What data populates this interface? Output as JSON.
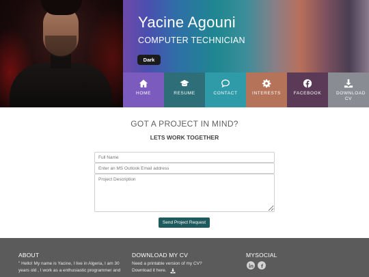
{
  "profile": {
    "name": "Yacine Agouni",
    "role": "COMPUTER TECHNICIAN",
    "theme_button": "Dark"
  },
  "nav": [
    {
      "label": "HOME",
      "icon": "home-icon",
      "color": "#7b5bbd"
    },
    {
      "label": "RESUME",
      "icon": "graduation-cap-icon",
      "color": "#2e6e78"
    },
    {
      "label": "CONTACT",
      "icon": "comment-icon",
      "color": "#2f9aa8"
    },
    {
      "label": "INTERESTS",
      "icon": "gear-icon",
      "color": "#b5735a"
    },
    {
      "label": "FACEBOOK",
      "icon": "facebook-icon",
      "color": "#5a3a56"
    },
    {
      "label": "DOWNLOAD CV",
      "icon": "download-icon",
      "color": "#8a8c93"
    }
  ],
  "contact": {
    "title": "GOT A PROJECT IN MIND?",
    "subtitle": "LETS WORK TOGETHER",
    "name_placeholder": "Full Name",
    "email_placeholder": "Enter an MS Outlook Email address",
    "description_placeholder": "Project Description",
    "send_label": "Send Project Request"
  },
  "footer": {
    "about_title": "ABOUT",
    "about_line1": "\" Hello! My name is Yacine, I live in Algeria, I am 30",
    "about_line2": "years old , I work as a enthusiastic programmer and",
    "cv_title": "DOWNLOAD MY CV",
    "cv_line1": "Need a printable version of my CV?",
    "cv_line2": "Download it here.",
    "social_title": "MYSOCIAL",
    "social_icons": [
      "linkedin-icon",
      "facebook-icon"
    ]
  }
}
